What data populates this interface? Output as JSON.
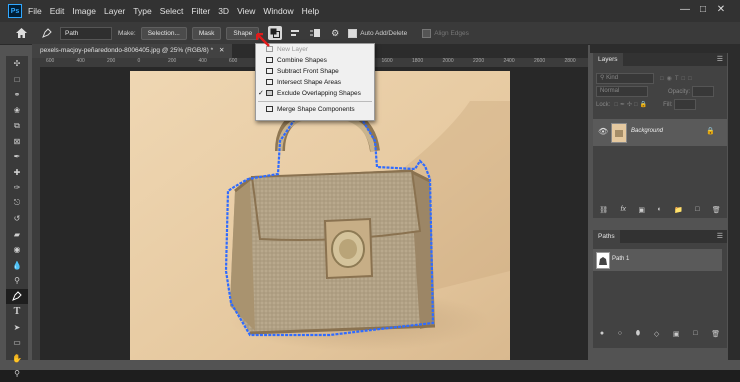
{
  "app": {
    "logo": "Ps"
  },
  "menu": [
    "File",
    "Edit",
    "Image",
    "Layer",
    "Type",
    "Select",
    "Filter",
    "3D",
    "View",
    "Window",
    "Help"
  ],
  "options": {
    "tool_mode": "Path",
    "make_label": "Make:",
    "selection_btn": "Selection...",
    "mask_btn": "Mask",
    "shape_btn": "Shape",
    "auto_add_delete": "Auto Add/Delete",
    "align_edges": "Align Edges"
  },
  "document": {
    "tab_title": "pexels-macjoy-peñaredondo-8006405.jpg @ 25% (RGB/8) *"
  },
  "ruler_numbers": [
    "600",
    "400",
    "200",
    "0",
    "200",
    "400",
    "600",
    "800",
    "1000",
    "1200",
    "1400",
    "1600",
    "1800",
    "2000",
    "2200",
    "2400",
    "2600",
    "2800"
  ],
  "path_ops_menu": {
    "items": [
      {
        "label": "New Layer",
        "disabled": true,
        "checked": false
      },
      {
        "label": "Combine Shapes",
        "disabled": false,
        "checked": false
      },
      {
        "label": "Subtract Front Shape",
        "disabled": false,
        "checked": false
      },
      {
        "label": "Intersect Shape Areas",
        "disabled": false,
        "checked": false
      },
      {
        "label": "Exclude Overlapping Shapes",
        "disabled": false,
        "checked": true
      }
    ],
    "merge": "Merge Shape Components"
  },
  "layers_panel": {
    "title": "Layers",
    "kind_placeholder": "Kind",
    "blend_mode": "Normal",
    "opacity_label": "Opacity:",
    "lock_label": "Lock:",
    "fill_label": "Fill:",
    "layer_name": "Background"
  },
  "paths_panel": {
    "title": "Paths",
    "path_name": "Path 1"
  },
  "colors": {
    "accent_path": "#2f6bff",
    "highlight_arrow": "#e11b1b",
    "photo_bg": "#e8cda6"
  },
  "icons": [
    "home-icon",
    "pen-tool-icon",
    "path-operations-icon",
    "path-alignment-icon",
    "path-arrangement-icon",
    "gear-icon",
    "eye-icon",
    "lock-icon"
  ]
}
